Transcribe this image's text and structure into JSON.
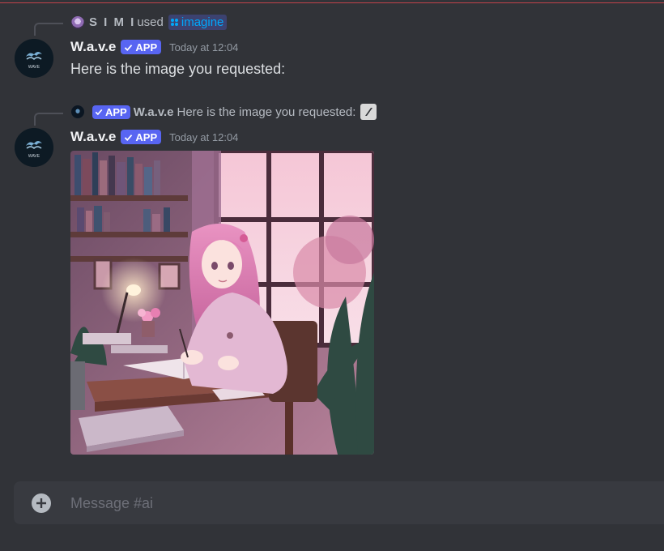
{
  "interaction": {
    "user": "S I M I",
    "verb": "used",
    "command": "imagine",
    "command_icon": "slash-command-icon"
  },
  "message1": {
    "author": "W.a.v.e",
    "badge": "APP",
    "timestamp": "Today at 12:04",
    "content": "Here is the image you requested:",
    "avatar_text": "WAVE"
  },
  "reply": {
    "badge": "APP",
    "author": "W.a.v.e",
    "content": "Here is the image you requested:",
    "attachment_icon": "image-icon"
  },
  "message2": {
    "author": "W.a.v.e",
    "badge": "APP",
    "timestamp": "Today at 12:04",
    "avatar_text": "WAVE",
    "attachment": {
      "type": "image"
    }
  },
  "composer": {
    "placeholder": "Message #ai",
    "add_icon": "plus-circle-icon"
  },
  "colors": {
    "background": "#313338",
    "accent": "#5865f2",
    "command_link": "#00a8fc",
    "composer": "#383a40"
  }
}
